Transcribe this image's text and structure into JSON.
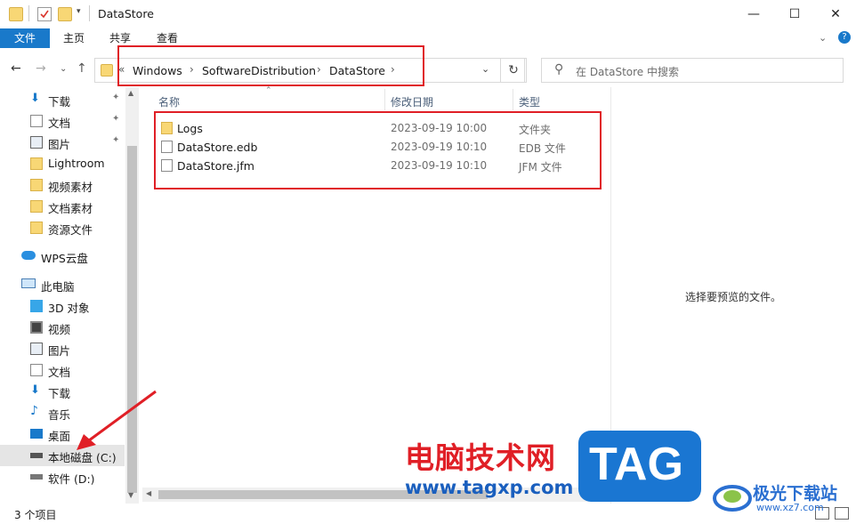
{
  "window": {
    "title": "DataStore",
    "minimize": "—",
    "maximize": "☐",
    "close": "✕"
  },
  "ribbon": {
    "tabs": [
      "文件",
      "主页",
      "共享",
      "查看"
    ]
  },
  "address": {
    "overflow": "«",
    "crumbs": [
      "Windows",
      "SoftwareDistribution",
      "DataStore"
    ],
    "search_placeholder": "在 DataStore 中搜索"
  },
  "sidebar": {
    "quick_access": [
      {
        "label": "下载",
        "icon": "download-icon",
        "pinned": true
      },
      {
        "label": "文档",
        "icon": "document-icon",
        "pinned": true
      },
      {
        "label": "图片",
        "icon": "picture-icon",
        "pinned": true
      },
      {
        "label": "Lightroom",
        "icon": "folder-icon",
        "pinned": false
      },
      {
        "label": "视频素材",
        "icon": "folder-icon",
        "pinned": false
      },
      {
        "label": "文档素材",
        "icon": "folder-icon",
        "pinned": false
      },
      {
        "label": "资源文件",
        "icon": "folder-icon",
        "pinned": false
      }
    ],
    "wps": "WPS云盘",
    "this_pc": "此电脑",
    "pc_items": [
      {
        "label": "3D 对象",
        "icon": "3d-objects-icon"
      },
      {
        "label": "视频",
        "icon": "video-icon"
      },
      {
        "label": "图片",
        "icon": "picture-icon"
      },
      {
        "label": "文档",
        "icon": "document-icon"
      },
      {
        "label": "下载",
        "icon": "download-icon"
      },
      {
        "label": "音乐",
        "icon": "music-icon"
      },
      {
        "label": "桌面",
        "icon": "desktop-icon"
      },
      {
        "label": "本地磁盘 (C:)",
        "icon": "drive-c-icon",
        "selected": true
      },
      {
        "label": "软件 (D:)",
        "icon": "drive-d-icon"
      }
    ],
    "pin_glyph": "📌"
  },
  "columns": {
    "name": "名称",
    "date": "修改日期",
    "type": "类型"
  },
  "files": [
    {
      "name": "Logs",
      "date": "2023-09-19 10:00",
      "type": "文件夹",
      "icon": "folder-icon"
    },
    {
      "name": "DataStore.edb",
      "date": "2023-09-19 10:10",
      "type": "EDB 文件",
      "icon": "file-icon"
    },
    {
      "name": "DataStore.jfm",
      "date": "2023-09-19 10:10",
      "type": "JFM 文件",
      "icon": "file-icon"
    }
  ],
  "preview": {
    "empty_text": "选择要预览的文件。"
  },
  "status": {
    "count": "3 个项目"
  },
  "watermark": {
    "cn": "电脑技术网",
    "url": "www.tagxp.com",
    "tag": "TAG",
    "brand": "极光下载站",
    "brand_url": "www.xz7.com"
  },
  "colors": {
    "accent": "#1979ca",
    "highlight": "#e01f26",
    "folder": "#f8d775"
  }
}
